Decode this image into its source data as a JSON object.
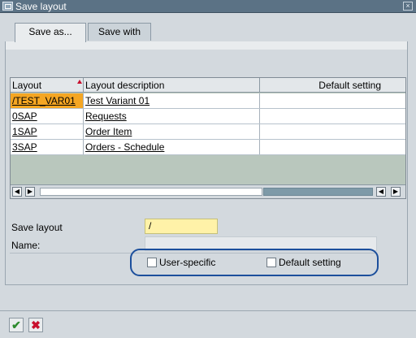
{
  "window": {
    "title": "Save layout",
    "close_symbol": "×"
  },
  "tabs": [
    {
      "label": "Save as..."
    },
    {
      "label": "Save with"
    }
  ],
  "table": {
    "columns": [
      "Layout",
      "Layout description",
      "Default setting"
    ],
    "rows": [
      {
        "layout": "/TEST_VAR01",
        "description": "Test Variant 01",
        "default": ""
      },
      {
        "layout": "0SAP",
        "description": "Requests",
        "default": ""
      },
      {
        "layout": "1SAP",
        "description": "Order Item",
        "default": ""
      },
      {
        "layout": "3SAP",
        "description": "Orders - Schedule",
        "default": ""
      }
    ],
    "selected_row": 0
  },
  "scroll": {
    "left_symbol": "◀",
    "right_symbol": "▶"
  },
  "form": {
    "save_layout_label": "Save layout",
    "save_layout_value": "/",
    "name_label": "Name:",
    "name_value": "",
    "user_specific_label": "User-specific",
    "default_setting_label": "Default setting"
  },
  "footer": {
    "ok_symbol": "✔",
    "cancel_symbol": "✖"
  }
}
